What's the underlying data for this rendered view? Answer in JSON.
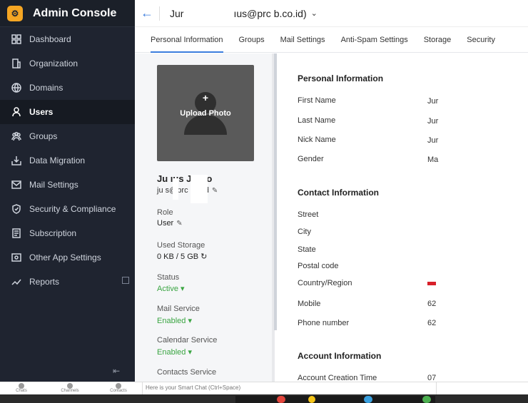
{
  "app": {
    "title": "Admin Console",
    "logo": "gear-logo-icon"
  },
  "sidebar": {
    "items": [
      {
        "label": "Dashboard",
        "icon": "dashboard-icon"
      },
      {
        "label": "Organization",
        "icon": "building-icon"
      },
      {
        "label": "Domains",
        "icon": "globe-icon"
      },
      {
        "label": "Users",
        "icon": "user-icon",
        "active": true
      },
      {
        "label": "Groups",
        "icon": "groups-icon"
      },
      {
        "label": "Data Migration",
        "icon": "migration-icon"
      },
      {
        "label": "Mail Settings",
        "icon": "mail-settings-icon"
      },
      {
        "label": "Security & Compliance",
        "icon": "shield-icon"
      },
      {
        "label": "Subscription",
        "icon": "subscription-icon"
      },
      {
        "label": "Other App Settings",
        "icon": "apps-icon"
      },
      {
        "label": "Reports",
        "icon": "reports-icon"
      }
    ]
  },
  "topbar": {
    "user_title": "Jur",
    "user_email_fragment": "ıus@prc    b.co.id)"
  },
  "tabs": [
    "Personal Information",
    "Groups",
    "Mail Settings",
    "Anti-Spam Settings",
    "Storage",
    "Security"
  ],
  "profile": {
    "upload_label": "Upload Photo",
    "name": "Ju  ıus Ju    rto",
    "email": "ju  s@prc     .co.id",
    "role_label": "Role",
    "role_value": "User",
    "storage_label": "Used Storage",
    "storage_value": "0 KB / 5 GB",
    "status_label": "Status",
    "status_value": "Active",
    "mail_label": "Mail Service",
    "mail_value": "Enabled",
    "calendar_label": "Calendar Service",
    "calendar_value": "Enabled",
    "contacts_label": "Contacts Service"
  },
  "personal": {
    "title": "Personal Information",
    "first_name_label": "First Name",
    "first_name_value": "Jur",
    "last_name_label": "Last Name",
    "last_name_value": "Jur",
    "nick_name_label": "Nick Name",
    "nick_name_value": "Jur",
    "gender_label": "Gender",
    "gender_value": "Ma"
  },
  "contact": {
    "title": "Contact Information",
    "street_label": "Street",
    "city_label": "City",
    "state_label": "State",
    "postal_label": "Postal code",
    "country_label": "Country/Region",
    "mobile_label": "Mobile",
    "mobile_value": "62",
    "phone_label": "Phone number",
    "phone_value": "62"
  },
  "account": {
    "title": "Account Information",
    "creation_label": "Account Creation Time",
    "creation_value": "07"
  },
  "chatbar": {
    "chats": "Chats",
    "channels": "Channels",
    "contacts": "Contacts",
    "smart_placeholder": "Here is your Smart Chat (Ctrl+Space)"
  }
}
